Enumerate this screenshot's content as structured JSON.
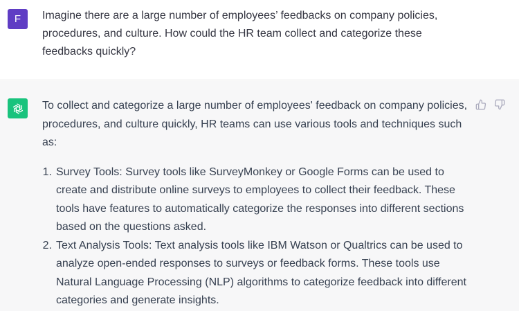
{
  "user": {
    "avatar_letter": "F",
    "message": "Imagine there are a large number of employees’ feedbacks on company policies, procedures, and culture. How could the HR team collect and categorize these feedbacks quickly?"
  },
  "assistant": {
    "avatar_icon": "openai-logo-icon",
    "intro": "To collect and categorize a large number of employees' feedback on company policies, procedures, and culture quickly, HR teams can use various tools and techniques such as:",
    "items": [
      {
        "number": "1.",
        "text": "Survey Tools: Survey tools like SurveyMonkey or Google Forms can be used to create and distribute online surveys to employees to collect their feedback. These tools have features to automatically categorize the responses into different sections based on the questions asked."
      },
      {
        "number": "2.",
        "text": "Text Analysis Tools: Text analysis tools like IBM Watson or Qualtrics can be used to analyze open-ended responses to surveys or feedback forms. These tools use Natural Language Processing (NLP) algorithms to categorize feedback into different categories and generate insights."
      }
    ],
    "feedback_icons": [
      "thumbs-up-icon",
      "thumbs-down-icon"
    ]
  },
  "colors": {
    "user_avatar_bg": "#5f3dc4",
    "assistant_avatar_bg": "#19c37d",
    "assistant_bg": "#f7f7f8"
  }
}
